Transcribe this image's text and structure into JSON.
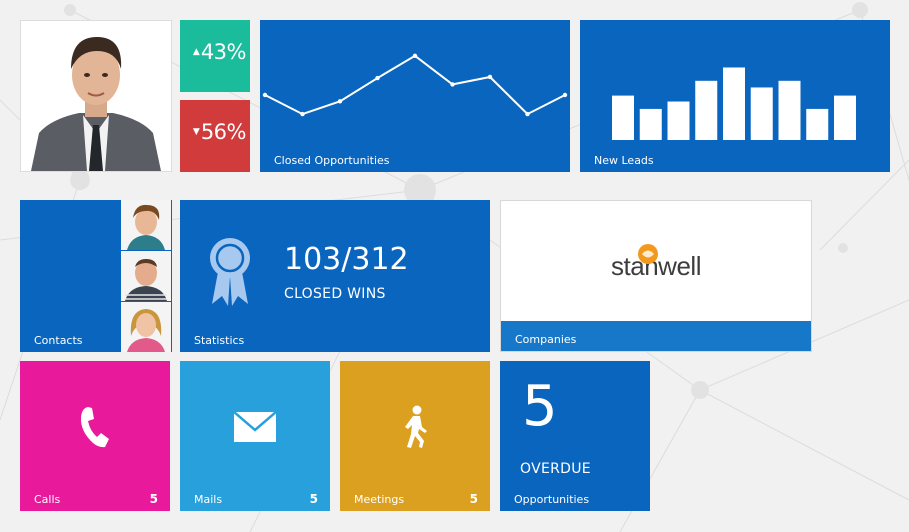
{
  "colors": {
    "primary_blue": "#0a65be",
    "kpi_up": "#1bbc9b",
    "kpi_down": "#d13b3b",
    "calls": "#e8199a",
    "mails": "#27a0dc",
    "meetings": "#dba020",
    "companies_bar": "#1778c9"
  },
  "kpis": {
    "up": {
      "value": "43%",
      "icon": "triangle-up-icon"
    },
    "down": {
      "value": "56%",
      "icon": "triangle-down-icon"
    }
  },
  "tiles": {
    "closed_opportunities": {
      "label": "Closed Opportunities"
    },
    "new_leads": {
      "label": "New Leads"
    },
    "contacts": {
      "label": "Contacts"
    },
    "statistics": {
      "label": "Statistics",
      "value": "103/312",
      "caption": "CLOSED WINS",
      "icon": "award-ribbon-icon"
    },
    "companies": {
      "label": "Companies",
      "logo_text": "stanwell"
    },
    "calls": {
      "label": "Calls",
      "count": "5",
      "icon": "phone-icon"
    },
    "mails": {
      "label": "Mails",
      "count": "5",
      "icon": "envelope-icon"
    },
    "meetings": {
      "label": "Meetings",
      "count": "5",
      "icon": "walking-person-icon"
    },
    "opportunities": {
      "label": "Opportunities",
      "value": "5",
      "caption": "OVERDUE"
    }
  },
  "chart_data": [
    {
      "type": "line",
      "values": [
        0.5,
        0.32,
        0.44,
        0.66,
        0.87,
        0.6,
        0.67,
        0.32,
        0.5
      ]
    },
    {
      "type": "bar",
      "values": [
        0.6,
        0.42,
        0.52,
        0.8,
        0.98,
        0.71,
        0.8,
        0.42,
        0.6
      ]
    }
  ]
}
